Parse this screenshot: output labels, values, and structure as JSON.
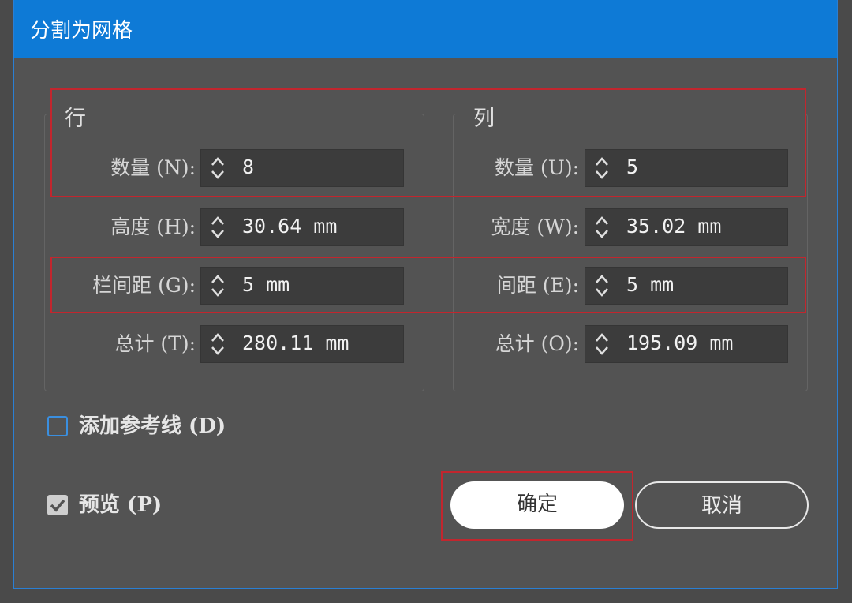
{
  "dialog": {
    "title": "分割为网格"
  },
  "rows": {
    "group_title": "行",
    "count_label": "数量 (N):",
    "count_value": "8",
    "height_label": "高度 (H):",
    "height_value": "30.64 mm",
    "gutter_label": "栏间距 (G):",
    "gutter_value": "5 mm",
    "total_label": "总计 (T):",
    "total_value": "280.11 mm"
  },
  "columns": {
    "group_title": "列",
    "count_label": "数量 (U):",
    "count_value": "5",
    "width_label": "宽度 (W):",
    "width_value": "35.02 mm",
    "gutter_label": "间距 (E):",
    "gutter_value": "5 mm",
    "total_label": "总计 (O):",
    "total_value": "195.09 mm"
  },
  "options": {
    "add_guides_label": "添加参考线 (D)",
    "add_guides_checked": false,
    "preview_label": "预览 (P)",
    "preview_checked": true
  },
  "buttons": {
    "ok_label": "确定",
    "cancel_label": "取消"
  },
  "colors": {
    "titlebar": "#0e7ad6",
    "dialog_bg": "#535353",
    "field_bg": "#3c3c3c",
    "highlight_box": "#c2262e",
    "checkbox_border": "#3a8fe0"
  }
}
